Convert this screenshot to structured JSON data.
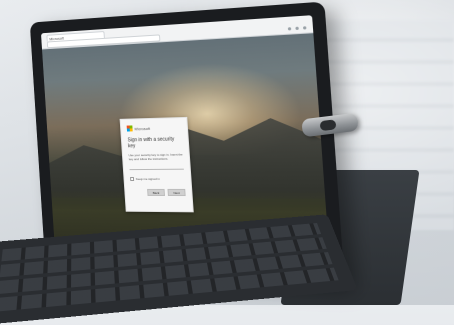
{
  "scene": {
    "browser": {
      "tab_label": "Microsoft"
    },
    "dialog": {
      "brand": "Microsoft",
      "title": "Sign in with a security key",
      "body": "Use your security key to sign in. Insert the key and follow the instructions.",
      "checkbox_label": "Keep me signed in",
      "primary_button": "Next",
      "secondary_button": "Back"
    },
    "colors": {
      "ms_red": "#f25022",
      "ms_green": "#7fba00",
      "ms_blue": "#00a4ef",
      "ms_yellow": "#ffb900"
    }
  }
}
